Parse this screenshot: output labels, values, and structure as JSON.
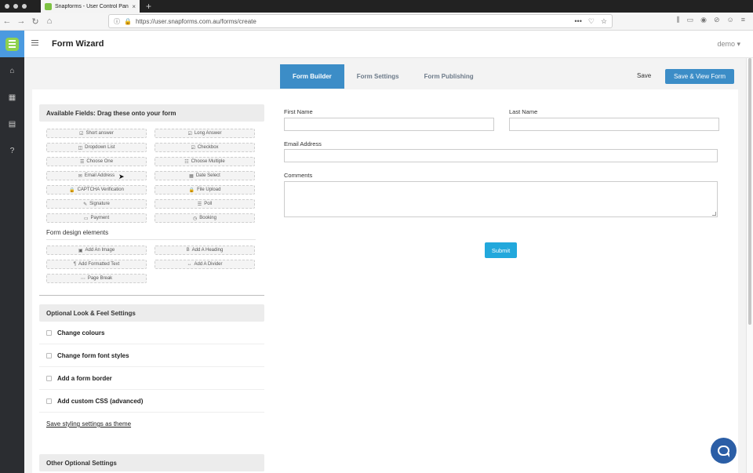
{
  "browser": {
    "tab_title": "Snapforms - User Control Pane",
    "tab_close": "×",
    "new_tab": "+",
    "back": "←",
    "forward": "→",
    "reload": "↻",
    "home": "⌂",
    "url": "https://user.snapforms.com.au/forms/create",
    "url_actions": [
      "•••",
      "♡",
      "☆"
    ],
    "toolbar_icons": [
      "⫼",
      "▭",
      "◉",
      "⊘",
      "☺",
      "≡"
    ]
  },
  "sidebar": {
    "icons": [
      "⌂",
      "▦",
      "▤",
      "?"
    ]
  },
  "header": {
    "title": "Form Wizard",
    "user": "demo",
    "user_caret": "▾"
  },
  "tabs": [
    "Form Builder",
    "Form Settings",
    "Form Publishing"
  ],
  "actions": {
    "save": "Save",
    "save_view": "Save & View Form"
  },
  "available_fields": {
    "title": "Available Fields: Drag these onto your form",
    "items": [
      {
        "icon": "☑",
        "label": "Short answer"
      },
      {
        "icon": "☑",
        "label": "Long Answer"
      },
      {
        "icon": "◫",
        "label": "Dropdown List"
      },
      {
        "icon": "☑",
        "label": "Checkbox"
      },
      {
        "icon": "☰",
        "label": "Choose One"
      },
      {
        "icon": "☷",
        "label": "Choose Multiple"
      },
      {
        "icon": "✉",
        "label": "Email Address"
      },
      {
        "icon": "▦",
        "label": "Date Select"
      },
      {
        "icon": "🔒",
        "label": "CAPTCHA Verification"
      },
      {
        "icon": "🔒",
        "label": "File Upload"
      },
      {
        "icon": "✎",
        "label": "Signature"
      },
      {
        "icon": "☰",
        "label": "Poll"
      },
      {
        "icon": "▭",
        "label": "Payment"
      },
      {
        "icon": "◷",
        "label": "Booking"
      }
    ]
  },
  "design_elements": {
    "title": "Form design elements",
    "items": [
      {
        "icon": "▣",
        "label": "Add An Image"
      },
      {
        "icon": "B",
        "label": "Add A Heading"
      },
      {
        "icon": "¶",
        "label": "Add Formatted Text"
      },
      {
        "icon": "↔",
        "label": "Add A Divider"
      },
      {
        "icon": "⋯",
        "label": "Page Break"
      }
    ]
  },
  "look_feel": {
    "title": "Optional Look & Feel Settings",
    "options": [
      "Change colours",
      "Change form font styles",
      "Add a form border",
      "Add custom CSS (advanced)"
    ],
    "theme_link": "Save styling settings as theme"
  },
  "other_settings": {
    "title": "Other Optional Settings"
  },
  "form_preview": {
    "first_name": "First Name",
    "last_name": "Last Name",
    "email": "Email Address",
    "comments": "Comments",
    "submit": "Submit"
  }
}
